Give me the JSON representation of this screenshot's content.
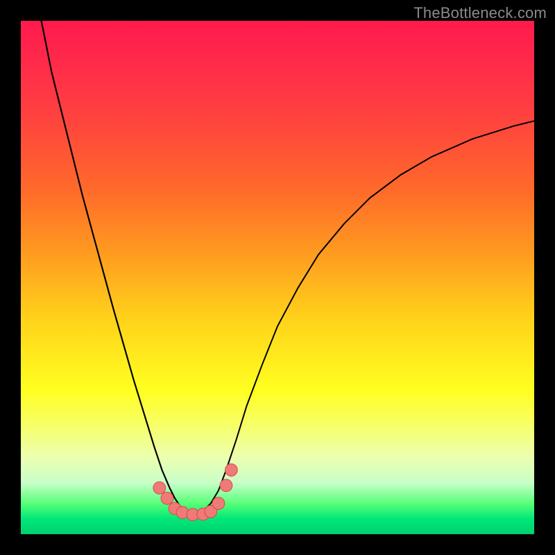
{
  "watermark": "TheBottleneck.com",
  "chart_data": {
    "type": "line",
    "title": "",
    "xlabel": "",
    "ylabel": "",
    "xlim": [
      0,
      100
    ],
    "ylim": [
      0,
      100
    ],
    "grid": false,
    "curve_left": {
      "x": [
        4.0,
        6.0,
        9.0,
        12.0,
        15.0,
        18.0,
        20.0,
        22.0,
        24.0,
        26.0,
        27.5,
        29.0,
        30.0,
        31.0,
        32.0,
        33.0,
        34.0
      ],
      "y": [
        100.0,
        90.0,
        78.0,
        66.0,
        55.0,
        44.0,
        37.0,
        30.0,
        23.5,
        17.0,
        12.5,
        9.0,
        7.0,
        5.5,
        4.5,
        4.0,
        3.8
      ]
    },
    "curve_right": {
      "x": [
        34.0,
        35.5,
        37.0,
        38.5,
        40.0,
        42.0,
        44.0,
        47.0,
        50.0,
        54.0,
        58.0,
        63.0,
        68.0,
        74.0,
        80.0,
        88.0,
        96.0,
        100.0
      ],
      "y": [
        3.8,
        4.5,
        6.0,
        8.5,
        12.5,
        18.5,
        25.0,
        33.0,
        40.5,
        48.0,
        54.5,
        60.5,
        65.5,
        70.0,
        73.5,
        77.0,
        79.5,
        80.5
      ]
    },
    "markers": [
      {
        "x": 27.0,
        "y": 9.0
      },
      {
        "x": 28.5,
        "y": 7.0
      },
      {
        "x": 30.0,
        "y": 5.0
      },
      {
        "x": 31.5,
        "y": 4.2
      },
      {
        "x": 33.5,
        "y": 3.8
      },
      {
        "x": 35.5,
        "y": 3.9
      },
      {
        "x": 37.0,
        "y": 4.4
      },
      {
        "x": 38.5,
        "y": 6.0
      },
      {
        "x": 40.0,
        "y": 9.5
      },
      {
        "x": 41.0,
        "y": 12.5
      }
    ],
    "marker_style": {
      "fill": "#ef7a78",
      "stroke": "#d74a48",
      "r_plot_units": 1.2
    }
  }
}
